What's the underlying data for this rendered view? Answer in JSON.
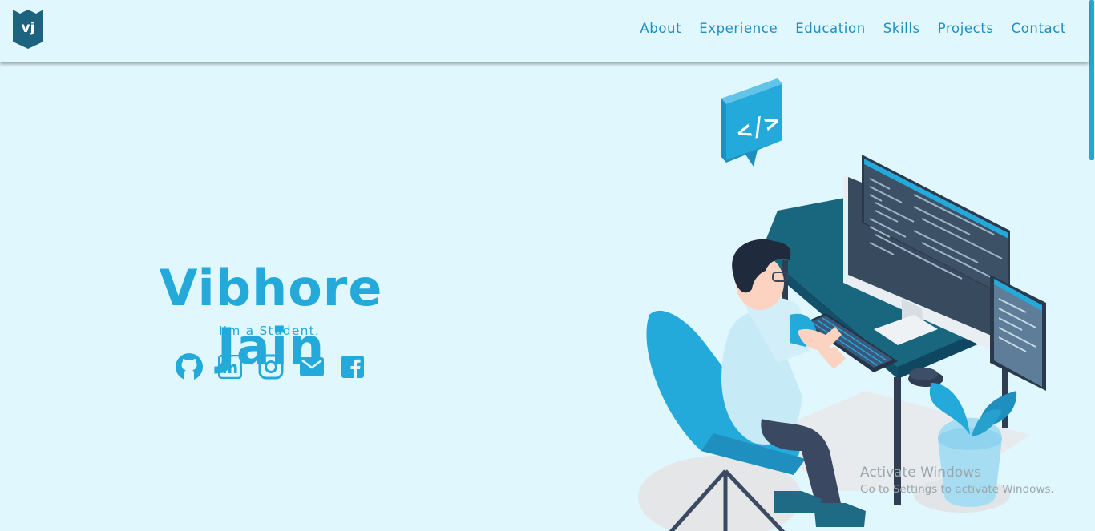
{
  "logo": {
    "text": "vj"
  },
  "nav": {
    "links": [
      "About",
      "Experience",
      "Education",
      "Skills",
      "Projects",
      "Contact"
    ]
  },
  "hero": {
    "name": "Vibhore Jain",
    "tagline": "I'm a Student."
  },
  "socials": [
    {
      "icon": "github-icon"
    },
    {
      "icon": "linkedin-icon"
    },
    {
      "icon": "instagram-icon"
    },
    {
      "icon": "email-icon"
    },
    {
      "icon": "facebook-icon"
    }
  ],
  "illustration": {
    "code_label": "</>"
  },
  "watermark": {
    "title": "Activate Windows",
    "subtitle": "Go to Settings to activate Windows."
  },
  "colors": {
    "background": "#e0f7fd",
    "accent": "#23a9da",
    "nav_text": "#1f8fc0",
    "logo_bg": "#1c6380"
  }
}
